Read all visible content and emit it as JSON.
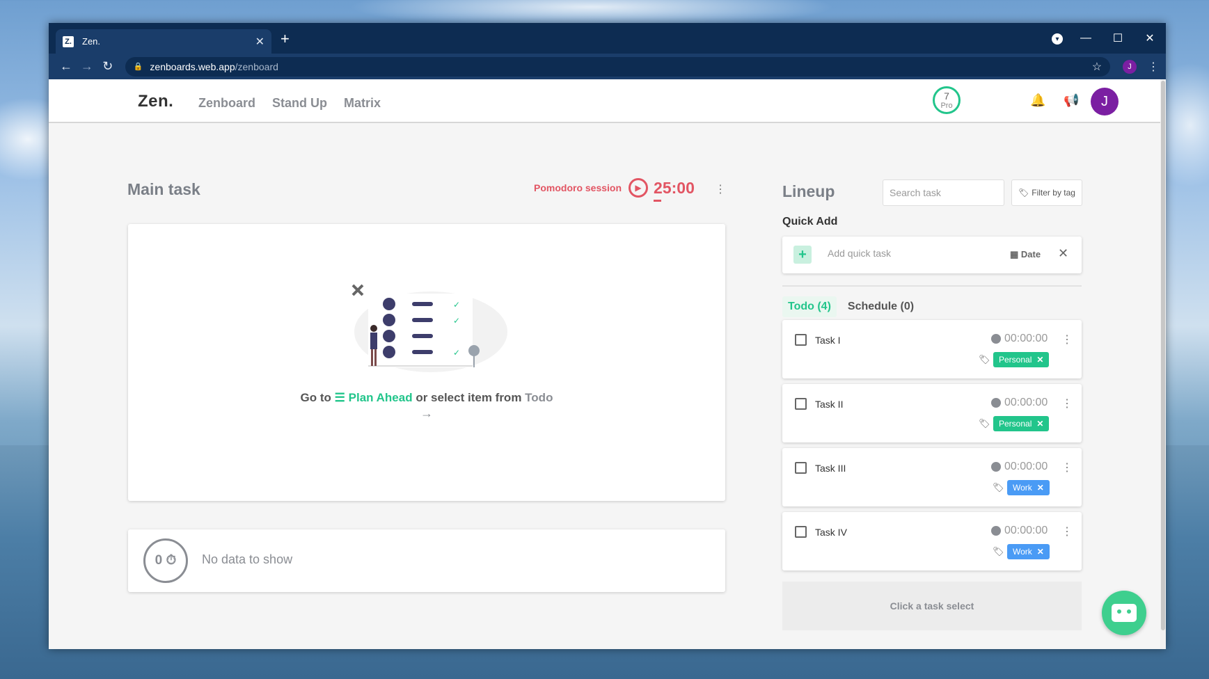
{
  "browser": {
    "tab_title": "Zen.",
    "tab_favicon": "Z.",
    "url_host": "zenboards.web.app",
    "url_path": "/zenboard",
    "profile_initial": "J"
  },
  "app": {
    "logo": "Zen.",
    "nav": [
      "Zenboard",
      "Stand Up",
      "Matrix"
    ],
    "pro_count": "7",
    "pro_label": "Pro",
    "avatar_initial": "J",
    "accent_color": "#22c58b",
    "avatar_color": "#7b1fa2"
  },
  "main": {
    "title": "Main task",
    "pomodoro_label": "Pomodoro session",
    "pomodoro_time": "25:00",
    "goto_prefix": "Go to",
    "plan_ahead": "Plan Ahead",
    "goto_middle": "or select item from",
    "goto_todo": "Todo",
    "stat_value": "0",
    "no_data": "No data to show"
  },
  "lineup": {
    "title": "Lineup",
    "search_placeholder": "Search task",
    "filter_label": "Filter by tag",
    "quick_add_title": "Quick Add",
    "quick_add_placeholder": "Add quick task",
    "date_label": "Date",
    "tabs": [
      "Todo (4)",
      "Schedule (0)"
    ],
    "tasks": [
      {
        "name": "Task I",
        "time": "00:00:00",
        "tag": "Personal"
      },
      {
        "name": "Task II",
        "time": "00:00:00",
        "tag": "Personal"
      },
      {
        "name": "Task III",
        "time": "00:00:00",
        "tag": "Work"
      },
      {
        "name": "Task IV",
        "time": "00:00:00",
        "tag": "Work"
      }
    ],
    "footer_hint": "Click a task select"
  }
}
